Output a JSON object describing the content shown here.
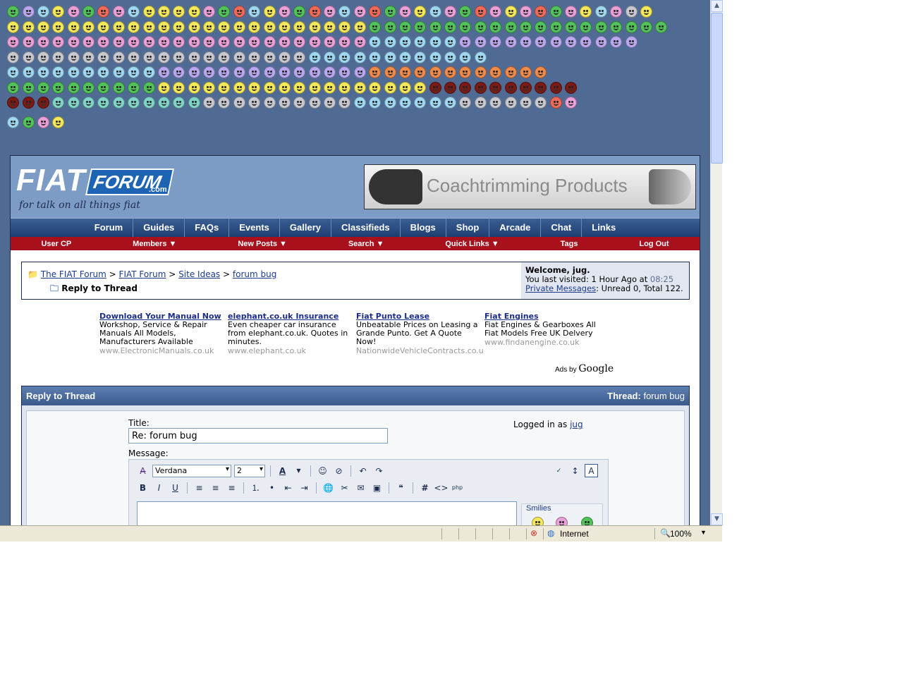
{
  "logo": {
    "word1": "FIAT",
    "word2": "FORUM",
    "domain": ".com",
    "tagline": "for talk on all things fiat"
  },
  "banner": {
    "text": "Coachtrimming Products"
  },
  "main_nav": [
    "Forum",
    "Guides",
    "FAQs",
    "Events",
    "Gallery",
    "Classifieds",
    "Blogs",
    "Shop",
    "Arcade",
    "Chat",
    "Links"
  ],
  "sub_nav": [
    {
      "label": "User CP",
      "dropdown": false
    },
    {
      "label": "Members",
      "dropdown": true
    },
    {
      "label": "New Posts",
      "dropdown": true
    },
    {
      "label": "Search",
      "dropdown": true
    },
    {
      "label": "Quick Links",
      "dropdown": true
    },
    {
      "label": "Tags",
      "dropdown": false
    },
    {
      "label": "Log Out",
      "dropdown": false
    }
  ],
  "breadcrumb": {
    "items": [
      "The FIAT Forum",
      "FIAT Forum",
      "Site Ideas",
      "forum bug"
    ],
    "separator": ">",
    "current": "Reply to Thread"
  },
  "welcome": {
    "greeting": "Welcome, jug.",
    "last_visit_prefix": "You last visited: 1 Hour Ago at",
    "last_visit_time": "08:25",
    "pm_link": "Private Messages",
    "pm_stats": ": Unread 0, Total 122."
  },
  "ads": [
    {
      "title": "Download Your Manual Now",
      "body": "Workshop, Service & Repair Manuals All Models, Manufacturers Available",
      "url": "www.ElectronicManuals.co.uk"
    },
    {
      "title": "elephant.co.uk Insurance",
      "body": "Even cheaper car insurance from elephant.co.uk. Quotes in minutes.",
      "url": "www.elephant.co.uk"
    },
    {
      "title": "Fiat Punto Lease",
      "body": "Unbeatable Prices on Leasing a Grande Punto. Get A Quote Now!",
      "url": "NationwideVehicleContracts.co.u"
    },
    {
      "title": "Fiat Engines",
      "body": "Fiat Engines & Gearboxes All Fiat Models Free UK Delvery",
      "url": "www.findanengine.co.uk"
    }
  ],
  "ads_by": {
    "prefix": "Ads by",
    "brand": "Google"
  },
  "reply": {
    "header": "Reply to Thread",
    "thread_label": "Thread:",
    "thread_name": "forum bug",
    "title_label": "Title:",
    "title_value": "Re: forum bug",
    "message_label": "Message:",
    "logged_in_prefix": "Logged in as",
    "logged_in_user": "jug",
    "font_select": "Verdana",
    "size_select": "2",
    "smilies_label": "Smilies"
  },
  "status": {
    "zone": "Internet",
    "zoom": "100%"
  },
  "colors": {
    "page_bg": "#4f6b94",
    "header_bg": "#7d9cc5",
    "nav_bg": "#1e3e70",
    "subnav_bg": "#a8101c"
  }
}
